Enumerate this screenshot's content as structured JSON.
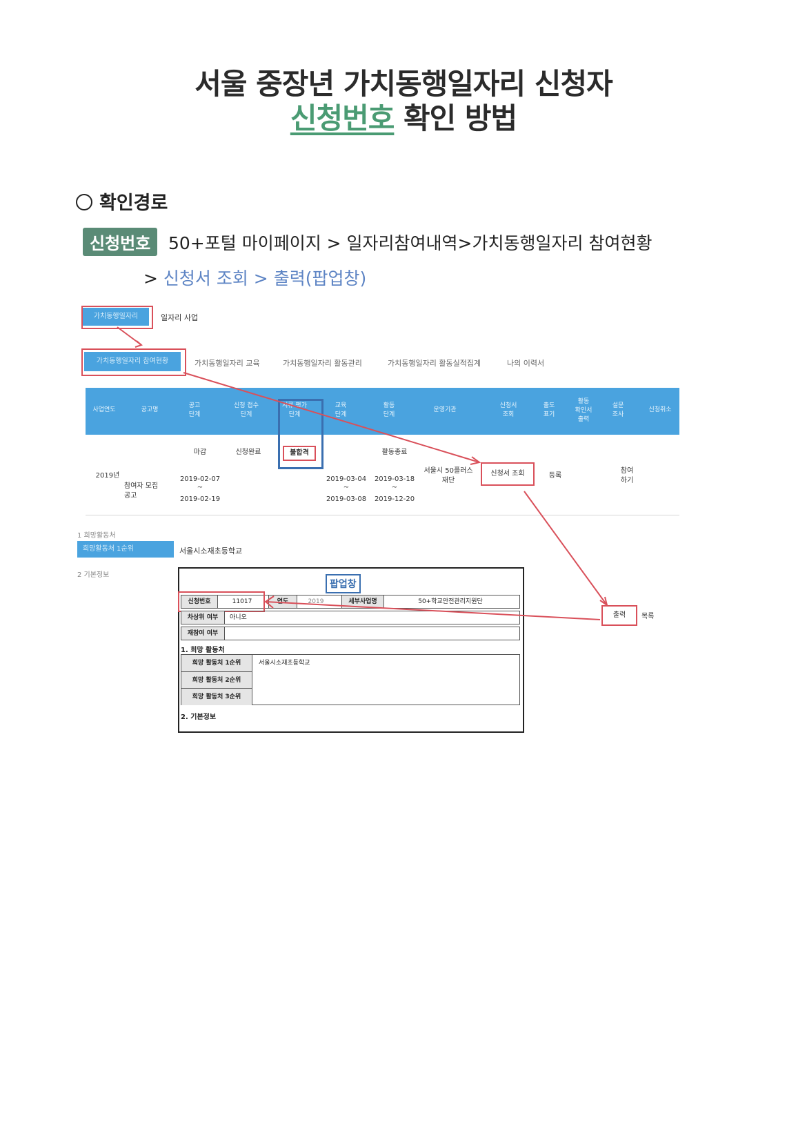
{
  "title": {
    "line1": "서울 중장년 가치동행일자리 신청자",
    "line2_highlight": "신청번호",
    "line2_rest": " 확인 방법"
  },
  "section": {
    "label": "확인경로"
  },
  "route": {
    "badge": "신청번호",
    "line1": "50+포털 마이페이지 > 일자리참여내역>가치동행일자리 참여현황",
    "line2_prefix": "> ",
    "line2_blue": "신청서 조회 > 출력(팝업창)"
  },
  "screenshot": {
    "top_tab": "가치동행일자리",
    "top_tab_side": "일자리 사업",
    "tabs": [
      "가치동행일자리 참여현황",
      "가치동행일자리 교육",
      "가치동행일자리 활동관리",
      "가치동행일자리 활동실적집계",
      "나의 이력서"
    ],
    "headers": [
      "사업연도",
      "공고명",
      "공고\n단계",
      "신청 접수\n단계",
      "서류 평가\n단계",
      "교육\n단계",
      "활동\n단계",
      "운영기관",
      "신청서\n조회",
      "출도\n표기",
      "활동\n확인서\n출력",
      "설문\n조사",
      "신청취소"
    ],
    "row": {
      "year": "2019년",
      "notice": "참여자 모집\n공고",
      "notice_stage": "마감",
      "notice_date1": "2019-02-07",
      "notice_date_sep": "~",
      "notice_date2": "2019-02-19",
      "apply_stage": "신청완료",
      "doc_stage": "불합격",
      "edu_date1": "2019-03-04",
      "edu_date_sep": "~",
      "edu_date2": "2019-03-08",
      "act_stage": "활동종료",
      "act_date1": "2019-03-18",
      "act_date_sep": "~",
      "act_date2": "2019-12-20",
      "org": "서울시 50플러스\n재단",
      "view_btn": "신청서 조회",
      "reg": "등록",
      "join": "참여\n하기"
    },
    "sec1": "1  희망활동처",
    "pref1_label": "희망활동처 1순위",
    "pref1_value": "서울시소재초등학교",
    "sec2": "2  기본정보",
    "popup": {
      "title": "팝업창",
      "app_no_label": "신청번호",
      "app_no_value": "11017",
      "year_label": "연도",
      "year_value": "2019",
      "biz_label": "세부사업명",
      "biz_value": "50+학교안전관리지원단",
      "row2_label": "차상위 여부",
      "row2_value": "아니오",
      "row3_label": "재참여 여부",
      "sec1": "1. 희망 활동처",
      "p1_label": "희망 활동처 1순위",
      "p1_value": "서울시소재초등학교",
      "p2_label": "희망 활동처 2순위",
      "p3_label": "희망 활동처 3순위",
      "sec2": "2. 기본정보"
    },
    "print_btn": "출력",
    "list_btn": "목록"
  },
  "colors": {
    "accent_green": "#4a9b73",
    "badge_green": "#5a8b76",
    "link_blue": "#5d84c4",
    "table_blue": "#4aa3df",
    "annotation_red": "#d9505a",
    "popup_blue": "#3a6fb0"
  }
}
